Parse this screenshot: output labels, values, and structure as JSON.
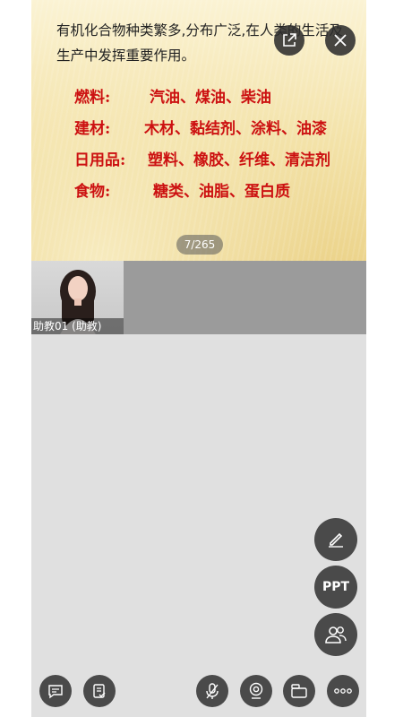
{
  "slide": {
    "intro": "有机化合物种类繁多,分布广泛,在人类的生活及生产中发挥重要作用。",
    "rows": [
      {
        "key": "燃料:",
        "value": "汽油、煤油、柴油"
      },
      {
        "key": "建材:",
        "value": "木材、黏结剂、涂料、油漆"
      },
      {
        "key": "日用品:",
        "value": "塑料、橡胶、纤维、清洁剂"
      },
      {
        "key": "食物:",
        "value": "糖类、油脂、蛋白质"
      }
    ],
    "page_indicator": "7/265"
  },
  "video": {
    "participant_name": "助教01 (助教)"
  },
  "fab": {
    "ppt_label": "PPT"
  },
  "icons": {
    "expand": "external-link-icon",
    "close": "close-icon",
    "pen": "pen-icon",
    "members": "members-icon",
    "chat": "chat-icon",
    "notes": "notes-icon",
    "mic": "mic-off-icon",
    "camera": "camera-icon",
    "layout": "layout-icon",
    "more": "more-icon"
  },
  "colors": {
    "slide_red": "#cc1111",
    "button_bg": "#4a4a4a",
    "panel_bg": "#e0e0e0"
  }
}
